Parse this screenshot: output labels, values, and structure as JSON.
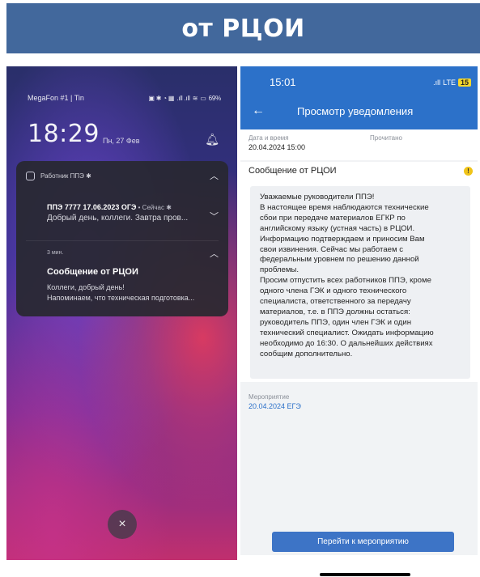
{
  "banner": {
    "title": "от РЦОИ"
  },
  "left_phone": {
    "status": {
      "carrier": "MegaFon #1 | Tin",
      "battery": "69%"
    },
    "clock": {
      "time": "18:29",
      "date": "Пн, 27 Фев"
    },
    "card": {
      "app_name": "Работник ППЭ ✱",
      "n1": {
        "title": "ППЭ 7777 17.06.2023 ОГЭ",
        "meta": " • Сейчас ✱",
        "body": "Добрый день, коллеги. Завтра пров..."
      },
      "n2": {
        "time": "3 мин.",
        "title": "Сообщение от РЦОИ",
        "body_lines": [
          "Коллеги, добрый день!",
          "Напоминаем, что техническая подготовка..."
        ]
      }
    },
    "close_symbol": "×"
  },
  "right_phone": {
    "status": {
      "time": "15:01",
      "network": "LTE",
      "battery": "15"
    },
    "nav": {
      "back_symbol": "←",
      "title": "Просмотр уведомления"
    },
    "info": {
      "date_label": "Дата и время",
      "date_value": "20.04.2024 15:00",
      "read_label": "Прочитано"
    },
    "message": {
      "title": "Сообщение от РЦОИ",
      "warn_symbol": "!",
      "lines": [
        "Уважаемые руководители ППЭ!",
        "В настоящее время наблюдаются технические",
        "сбои при передаче материалов ЕГКР по",
        "английскому языку (устная часть) в РЦОИ.",
        "Информацию подтверждаем и приносим Вам",
        "свои извинения. Сейчас мы работаем с",
        "федеральным уровнем по решению данной",
        "проблемы.",
        "Просим отпустить всех работников ППЭ, кроме",
        "одного члена ГЭК и одного технического",
        "специалиста, ответственного за передачу",
        "материалов, т.е. в ППЭ должны остаться:",
        "руководитель ППЭ, один член ГЭК и один",
        "технический специалист. Ожидать информацию",
        "необходимо до 16:30. О дальнейших действиях",
        "сообщим дополнительно."
      ]
    },
    "event": {
      "label": "Мероприятие",
      "value": "20.04.2024 ЕГЭ"
    },
    "button_label": "Перейти к мероприятию"
  }
}
